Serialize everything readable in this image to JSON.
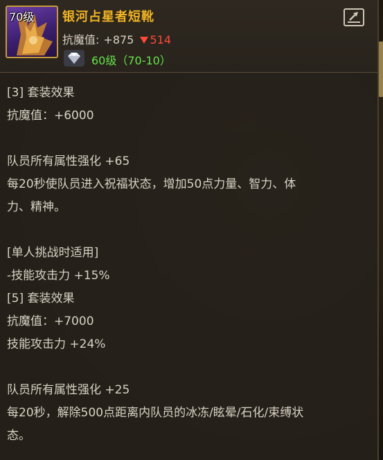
{
  "item": {
    "level_tag": "70级",
    "name": "银河占星者短靴",
    "stat_label": "抗魔值:",
    "stat_value": "+875",
    "stat_diff": "514",
    "gem_text": "60级（70-10）"
  },
  "colors": {
    "name": "#f0b323",
    "text": "#d8d2c4",
    "diff": "#ff4a3a",
    "gem": "#66e34b"
  },
  "icons": {
    "share": "share-icon",
    "gem": "diamond-icon",
    "diff": "down-triangle-icon"
  },
  "set_bonus_3": {
    "title": "[3] 套装效果",
    "stat": "抗魔值：+6000",
    "team_title": "队员所有属性强化 +65",
    "team_desc_1": "每20秒使队员进入祝福状态，增加50点力量、智力、体",
    "team_desc_2": "力、精神。",
    "solo_title": "[单人挑战时适用]",
    "solo_desc": "-技能攻击力 +15%"
  },
  "set_bonus_5": {
    "title": "[5] 套装效果",
    "stat": "抗魔值：+7000",
    "skill": "技能攻击力 +24%",
    "team_title": "队员所有属性强化 +25",
    "team_desc_1": "每20秒，解除500点距离内队员的冰冻/眩晕/石化/束缚状",
    "team_desc_2": "态。"
  }
}
